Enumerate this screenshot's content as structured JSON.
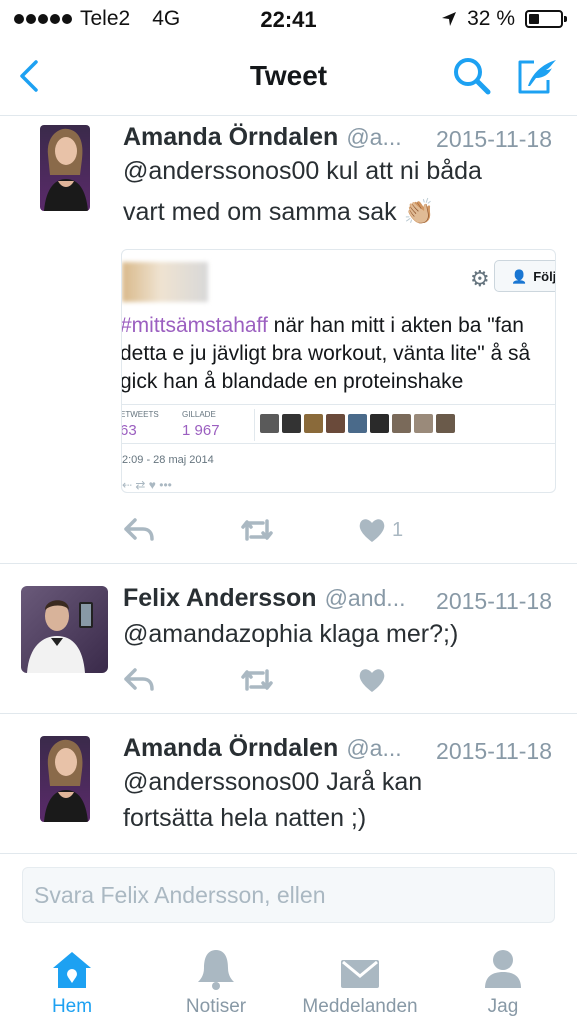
{
  "status_bar": {
    "carrier": "Tele2",
    "network": "4G",
    "time": "22:41",
    "battery": "32 %",
    "battery_level": 0.32
  },
  "nav": {
    "title": "Tweet",
    "back_icon": "chevron-left-icon",
    "search_icon": "search-icon",
    "compose_icon": "compose-tweet-icon"
  },
  "colors": {
    "accent": "#1da1f2",
    "muted": "#8899a6",
    "action_icon": "#aab8c2",
    "hashtag": "#9b5fc0"
  },
  "tweets": [
    {
      "name": "Amanda Örndalen",
      "handle": "@a...",
      "date": "2015-11-18",
      "text_line1": "@anderssonos00 kul att ni båda",
      "text_line2": "vart med om samma sak 👏🏼",
      "like_count": "1",
      "embed": {
        "follow_label": "Följ",
        "hashtag": "#mittsämstahaff",
        "line1_rest": " när han mitt i akten ba \"fan",
        "line2": "detta e ju jävligt bra workout, vänta lite\" å så",
        "line3": "gick han å blandade en proteinshake",
        "retweets_label": "ETWEETS",
        "retweets_value": "63",
        "likes_label": "GILLADE",
        "likes_value": "1 967",
        "timestamp": "2:09 - 28 maj 2014",
        "actions": "⇠   ⇄   ♥   •••"
      }
    },
    {
      "name": "Felix Andersson",
      "handle": "@and...",
      "date": "2015-11-18",
      "text_line1": "@amandazophia klaga mer?;)"
    },
    {
      "name": "Amanda Örndalen",
      "handle": "@a...",
      "date": "2015-11-18",
      "text_line1": "@anderssonos00 Jarå kan",
      "text_line2": "fortsätta hela natten ;)"
    }
  ],
  "reply": {
    "placeholder": "Svara Felix Andersson, ellen"
  },
  "tabs": [
    {
      "label": "Hem",
      "icon": "home-icon",
      "active": true
    },
    {
      "label": "Notiser",
      "icon": "bell-icon",
      "active": false
    },
    {
      "label": "Meddelanden",
      "icon": "envelope-icon",
      "active": false
    },
    {
      "label": "Jag",
      "icon": "person-icon",
      "active": false
    }
  ]
}
